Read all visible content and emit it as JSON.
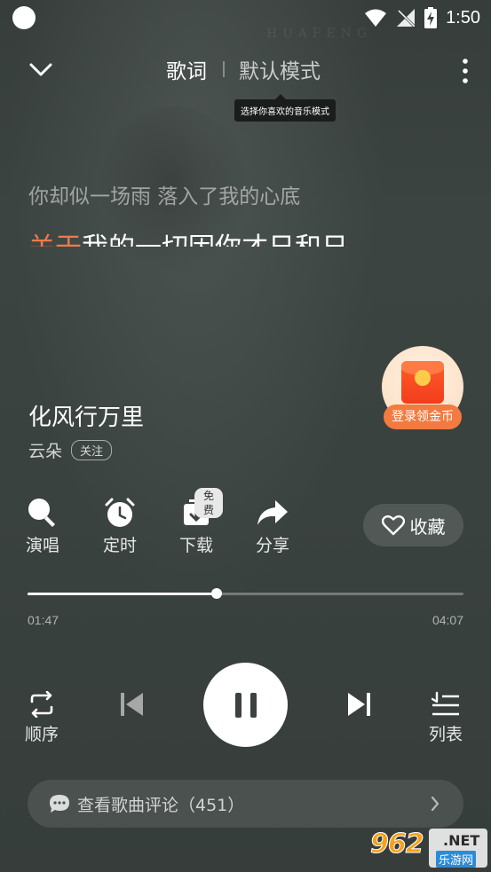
{
  "status_bar": {
    "time": "1:50",
    "icons": [
      "notification-dot",
      "wifi-icon",
      "no-signal-icon",
      "battery-charging-icon"
    ]
  },
  "header": {
    "tab_lyrics": "歌词",
    "tab_mode": "默认模式",
    "tooltip": "选择你喜欢的音乐模式",
    "back_icon": "chevron-down-icon",
    "more_icon": "more-vertical-icon"
  },
  "lyrics": {
    "line1": "你却似一场雨 落入了我的心底",
    "line2_highlight": "关于",
    "line2_rest": "我的一切因你才日和日"
  },
  "coin_badge": {
    "label": "登录领金币"
  },
  "song": {
    "title": "化风行万里",
    "artist": "云朵",
    "follow_label": "关注"
  },
  "actions": [
    {
      "label": "演唱",
      "icon": "microphone-icon"
    },
    {
      "label": "定时",
      "icon": "alarm-clock-icon"
    },
    {
      "label": "下载",
      "icon": "download-icon",
      "badge": "免费"
    },
    {
      "label": "分享",
      "icon": "share-arrow-icon"
    }
  ],
  "collect": {
    "label": "收藏",
    "icon": "heart-outline-icon"
  },
  "playback": {
    "current": "01:47",
    "total": "04:07",
    "progress_fraction": 0.433
  },
  "controls": {
    "order_label": "顺序",
    "list_label": "列表",
    "icons": [
      "repeat-icon",
      "previous-icon",
      "pause-icon",
      "next-icon",
      "playlist-icon"
    ]
  },
  "comments": {
    "label": "查看歌曲评论（451）",
    "icon": "comment-bubble-icon"
  },
  "watermark": {
    "number": "962",
    "domain": ".NET",
    "subtitle": "乐游网"
  },
  "colors": {
    "background": "#3b4240",
    "lyric_highlight": "#f07a47",
    "coin_label": "#f37b3f"
  }
}
